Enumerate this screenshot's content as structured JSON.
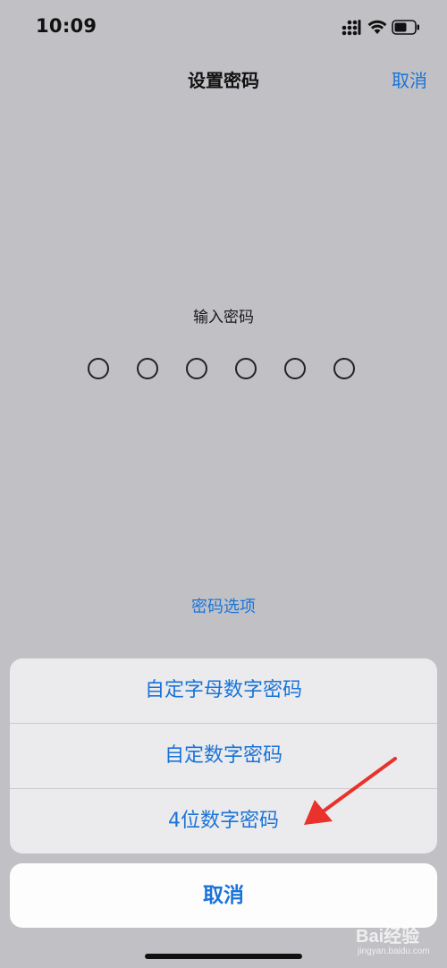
{
  "status_bar": {
    "time": "10:09",
    "icons": [
      "signal-icon",
      "wifi-icon",
      "battery-icon"
    ]
  },
  "nav": {
    "title": "设置密码",
    "cancel_label": "取消"
  },
  "passcode": {
    "prompt": "输入密码",
    "digit_count": 6,
    "filled_count": 0
  },
  "options_link": "密码选项",
  "action_sheet": {
    "items": [
      {
        "label": "自定字母数字密码"
      },
      {
        "label": "自定数字密码"
      },
      {
        "label": "4位数字密码"
      }
    ],
    "cancel_label": "取消"
  },
  "watermark": {
    "brand": "Bai经验",
    "url": "jingyan.baidu.com"
  },
  "colors": {
    "background": "#c1c1c5",
    "accent": "#1a73d8",
    "annotation": "#e8322b"
  }
}
